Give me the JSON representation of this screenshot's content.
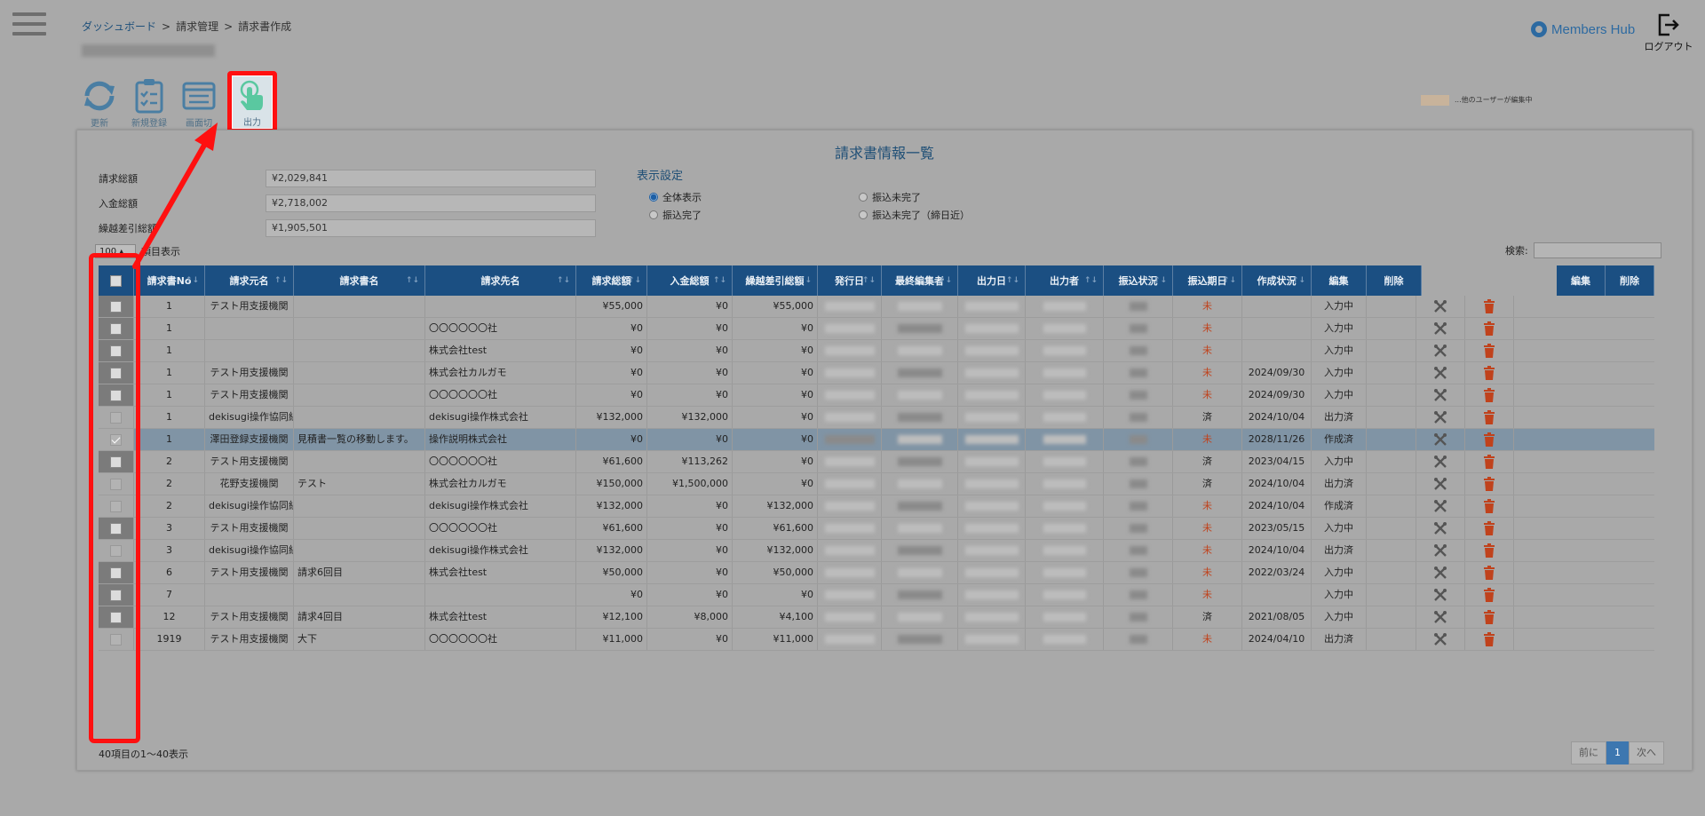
{
  "breadcrumb": [
    "ダッシュボード",
    "請求管理",
    "請求書作成"
  ],
  "breadcrumb_sep": ">",
  "logo_text": "Members Hub",
  "logout_label": "ログアウト",
  "toolbar": {
    "refresh": "更新",
    "new": "新規登録",
    "screen": "画面切",
    "output": "出力"
  },
  "legend_text": "...他のユーザーが編集中",
  "colors": {
    "header": "#1b4f82",
    "accent": "#1f4f76",
    "highlight": "#ff1010",
    "output_icon": "#5ac8a0"
  },
  "panel_title": "請求書情報一覧",
  "summary": [
    {
      "label": "請求総額",
      "value": "¥2,029,841"
    },
    {
      "label": "入金総額",
      "value": "¥2,718,002"
    },
    {
      "label": "繰越差引総額",
      "value": "¥1,905,501"
    }
  ],
  "display_settings": {
    "title": "表示設定",
    "options": [
      "全体表示",
      "振込未完了",
      "振込完了",
      "振込未完了（締日近）"
    ],
    "selected": "全体表示"
  },
  "page_size": {
    "value": "100",
    "suffix": "項目表示"
  },
  "search_label": "検索:",
  "columns": [
    "",
    "請求書No",
    "請求元名",
    "請求書名",
    "請求先名",
    "請求総額",
    "入金総額",
    "繰越差引総額",
    "発行日",
    "最終編集者",
    "出力日",
    "出力者",
    "振込状況",
    "振込期日",
    "作成状況",
    "編集",
    "削除"
  ],
  "fixed_columns": [
    "編集",
    "削除"
  ],
  "rows": [
    {
      "no": "1",
      "from": "テスト用支援機関",
      "name": "",
      "to": "",
      "total": "¥55,000",
      "paid": "¥0",
      "carry": "¥55,000",
      "pay": "未",
      "date": "",
      "status": "入力中",
      "checked": false,
      "light": false
    },
    {
      "no": "1",
      "from": "",
      "name": "",
      "to": "〇〇〇〇〇〇社",
      "total": "¥0",
      "paid": "¥0",
      "carry": "¥0",
      "pay": "未",
      "date": "",
      "status": "入力中",
      "checked": false,
      "light": false
    },
    {
      "no": "1",
      "from": "",
      "name": "",
      "to": "株式会社test",
      "total": "¥0",
      "paid": "¥0",
      "carry": "¥0",
      "pay": "未",
      "date": "",
      "status": "入力中",
      "checked": false,
      "light": false
    },
    {
      "no": "1",
      "from": "テスト用支援機関",
      "name": "",
      "to": "株式会社カルガモ",
      "total": "¥0",
      "paid": "¥0",
      "carry": "¥0",
      "pay": "未",
      "date": "2024/09/30",
      "status": "入力中",
      "checked": false,
      "light": false
    },
    {
      "no": "1",
      "from": "テスト用支援機関",
      "name": "",
      "to": "〇〇〇〇〇〇社",
      "total": "¥0",
      "paid": "¥0",
      "carry": "¥0",
      "pay": "未",
      "date": "2024/09/30",
      "status": "入力中",
      "checked": false,
      "light": false
    },
    {
      "no": "1",
      "from": "dekisugi操作協同組合",
      "name": "",
      "to": "dekisugi操作株式会社",
      "total": "¥132,000",
      "paid": "¥132,000",
      "carry": "¥0",
      "pay": "済",
      "date": "2024/10/04",
      "status": "出力済",
      "checked": false,
      "light": true
    },
    {
      "no": "1",
      "from": "澤田登録支援機関",
      "name": "見積書一覧の移動します。",
      "to": "操作説明株式会社",
      "total": "¥0",
      "paid": "¥0",
      "carry": "¥0",
      "pay": "未",
      "date": "2028/11/26",
      "status": "作成済",
      "checked": true,
      "light": true,
      "selected": true
    },
    {
      "no": "2",
      "from": "テスト用支援機関",
      "name": "",
      "to": "〇〇〇〇〇〇社",
      "total": "¥61,600",
      "paid": "¥113,262",
      "carry": "¥0",
      "pay": "済",
      "date": "2023/04/15",
      "status": "入力中",
      "checked": false,
      "light": false
    },
    {
      "no": "2",
      "from": "花野支援機関",
      "name": "テスト",
      "to": "株式会社カルガモ",
      "total": "¥150,000",
      "paid": "¥1,500,000",
      "carry": "¥0",
      "pay": "済",
      "date": "2024/10/04",
      "status": "出力済",
      "checked": false,
      "light": true
    },
    {
      "no": "2",
      "from": "dekisugi操作協同組合",
      "name": "",
      "to": "dekisugi操作株式会社",
      "total": "¥132,000",
      "paid": "¥0",
      "carry": "¥132,000",
      "pay": "未",
      "date": "2024/10/04",
      "status": "作成済",
      "checked": false,
      "light": true
    },
    {
      "no": "3",
      "from": "テスト用支援機関",
      "name": "",
      "to": "〇〇〇〇〇〇社",
      "total": "¥61,600",
      "paid": "¥0",
      "carry": "¥61,600",
      "pay": "未",
      "date": "2023/05/15",
      "status": "入力中",
      "checked": false,
      "light": false
    },
    {
      "no": "3",
      "from": "dekisugi操作協同組合",
      "name": "",
      "to": "dekisugi操作株式会社",
      "total": "¥132,000",
      "paid": "¥0",
      "carry": "¥132,000",
      "pay": "未",
      "date": "2024/10/04",
      "status": "出力済",
      "checked": false,
      "light": true
    },
    {
      "no": "6",
      "from": "テスト用支援機関",
      "name": "請求6回目",
      "to": "株式会社test",
      "total": "¥50,000",
      "paid": "¥0",
      "carry": "¥50,000",
      "pay": "未",
      "date": "2022/03/24",
      "status": "入力中",
      "checked": false,
      "light": false
    },
    {
      "no": "7",
      "from": "",
      "name": "",
      "to": "",
      "total": "¥0",
      "paid": "¥0",
      "carry": "¥0",
      "pay": "未",
      "date": "",
      "status": "入力中",
      "checked": false,
      "light": false
    },
    {
      "no": "12",
      "from": "テスト用支援機関",
      "name": "請求4回目",
      "to": "株式会社test",
      "total": "¥12,100",
      "paid": "¥8,000",
      "carry": "¥4,100",
      "pay": "済",
      "date": "2021/08/05",
      "status": "入力中",
      "checked": false,
      "light": false
    },
    {
      "no": "1919",
      "from": "テスト用支援機関",
      "name": "大下",
      "to": "〇〇〇〇〇〇社",
      "total": "¥11,000",
      "paid": "¥0",
      "carry": "¥11,000",
      "pay": "未",
      "date": "2024/04/10",
      "status": "出力済",
      "checked": false,
      "light": true
    }
  ],
  "footer_count": "40項目の1～40表示",
  "pager": {
    "prev": "前に",
    "current": "1",
    "next": "次へ"
  }
}
